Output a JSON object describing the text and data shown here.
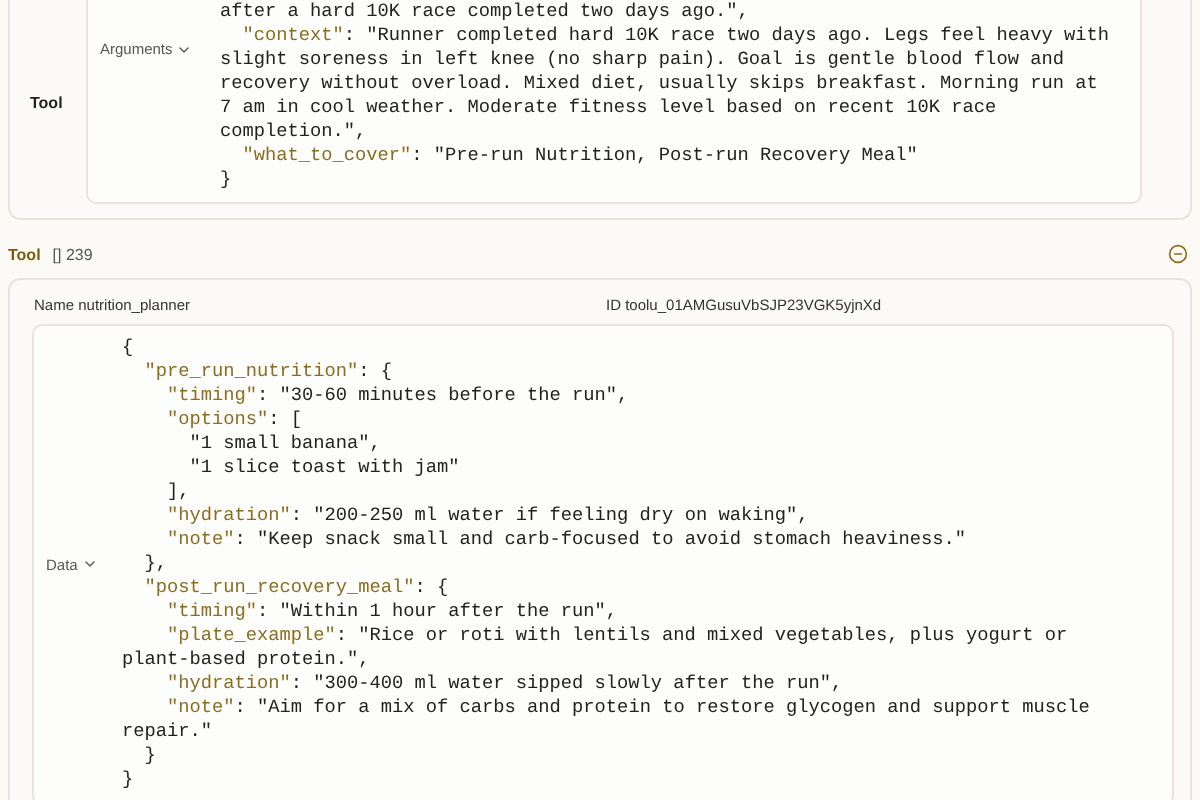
{
  "arguments_panel": {
    "label": "Tool",
    "toggle": "Arguments",
    "expanded": true,
    "lines": [
      {
        "text": "after a hard 10K race completed two days ago.\","
      },
      {
        "key": "  \"context\"",
        "text": ": \"Runner completed hard 10K race two days ago. Legs feel heavy with slight soreness in left knee (no sharp pain). Goal is gentle blood flow and recovery without overload. Mixed diet, usually skips breakfast. Morning run at 7 am in cool weather. Moderate fitness level based on recent 10K race completion.\","
      },
      {
        "key": "  \"what_to_cover\"",
        "text": ": \"Pre-run Nutrition, Post-run Recovery Meal\""
      },
      {
        "text": "}"
      }
    ]
  },
  "result_panel": {
    "label": "Tool",
    "badge": "[] 239",
    "name_label": "Name",
    "name": "nutrition_planner",
    "id_label": "ID",
    "id": "toolu_01AMGusuVbSJP23VGK5yjnXd",
    "toggle": "Data",
    "expanded": true,
    "lines": [
      {
        "text": "{"
      },
      {
        "key": "  \"pre_run_nutrition\"",
        "text": ": {"
      },
      {
        "key": "    \"timing\"",
        "text": ": \"30-60 minutes before the run\","
      },
      {
        "key": "    \"options\"",
        "text": ": ["
      },
      {
        "text": "      \"1 small banana\","
      },
      {
        "text": "      \"1 slice toast with jam\""
      },
      {
        "text": "    ],"
      },
      {
        "key": "    \"hydration\"",
        "text": ": \"200-250 ml water if feeling dry on waking\","
      },
      {
        "key": "    \"note\"",
        "text": ": \"Keep snack small and carb-focused to avoid stomach heaviness.\""
      },
      {
        "text": "  },"
      },
      {
        "key": "  \"post_run_recovery_meal\"",
        "text": ": {"
      },
      {
        "key": "    \"timing\"",
        "text": ": \"Within 1 hour after the run\","
      },
      {
        "key": "    \"plate_example\"",
        "text": ": \"Rice or roti with lentils and mixed vegetables, plus yogurt or plant-based protein.\","
      },
      {
        "key": "    \"hydration\"",
        "text": ": \"300-400 ml water sipped slowly after the run\","
      },
      {
        "key": "    \"note\"",
        "text": ": \"Aim for a mix of carbs and protein to restore glycogen and support muscle repair.\""
      },
      {
        "text": "  }"
      },
      {
        "text": "}"
      }
    ]
  }
}
